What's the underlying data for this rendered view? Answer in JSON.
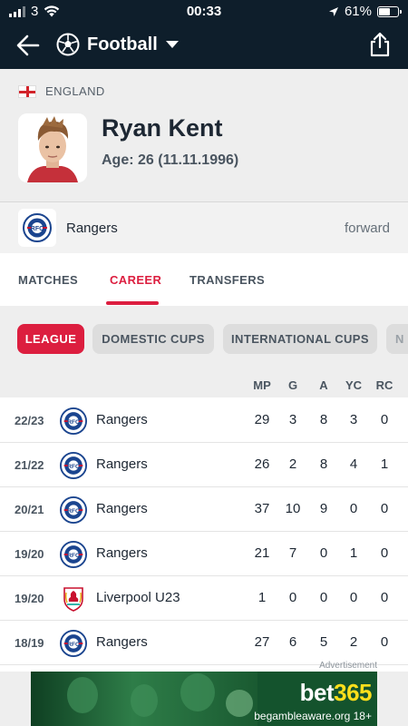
{
  "status_bar": {
    "carrier": "3",
    "time": "00:33",
    "battery": "61%",
    "battery_level": 0.61
  },
  "nav": {
    "sport": "Football",
    "icons": {
      "back": "back-arrow-icon",
      "sport": "football-icon",
      "dropdown": "chevron-down-icon",
      "share": "share-icon"
    }
  },
  "player": {
    "country": "ENGLAND",
    "name": "Ryan Kent",
    "age": "Age: 26 (11.11.1996)"
  },
  "team": {
    "name": "Rangers",
    "position": "forward"
  },
  "tabs": [
    {
      "label": "MATCHES",
      "active": false
    },
    {
      "label": "CAREER",
      "active": true
    },
    {
      "label": "TRANSFERS",
      "active": false
    }
  ],
  "filters": [
    {
      "label": "LEAGUE",
      "active": true
    },
    {
      "label": "DOMESTIC CUPS",
      "active": false
    },
    {
      "label": "INTERNATIONAL CUPS",
      "active": false
    },
    {
      "label": "N",
      "active": false
    }
  ],
  "career_table": {
    "columns": [
      "MP",
      "G",
      "A",
      "YC",
      "RC"
    ],
    "rows": [
      {
        "season": "22/23",
        "team": "Rangers",
        "crest": "rangers",
        "mp": "29",
        "g": "3",
        "a": "8",
        "yc": "3",
        "rc": "0"
      },
      {
        "season": "21/22",
        "team": "Rangers",
        "crest": "rangers",
        "mp": "26",
        "g": "2",
        "a": "8",
        "yc": "4",
        "rc": "1"
      },
      {
        "season": "20/21",
        "team": "Rangers",
        "crest": "rangers",
        "mp": "37",
        "g": "10",
        "a": "9",
        "yc": "0",
        "rc": "0"
      },
      {
        "season": "19/20",
        "team": "Rangers",
        "crest": "rangers",
        "mp": "21",
        "g": "7",
        "a": "0",
        "yc": "1",
        "rc": "0"
      },
      {
        "season": "19/20",
        "team": "Liverpool U23",
        "crest": "liverpool",
        "mp": "1",
        "g": "0",
        "a": "0",
        "yc": "0",
        "rc": "0"
      },
      {
        "season": "18/19",
        "team": "Rangers",
        "crest": "rangers",
        "mp": "27",
        "g": "6",
        "a": "5",
        "yc": "2",
        "rc": "0"
      }
    ]
  },
  "ad": {
    "label": "Advertisement",
    "brand_a": "bet",
    "brand_b": "365",
    "disclaimer": "begambleaware.org 18+"
  },
  "colors": {
    "nav_bg": "#0e1e2b",
    "accent": "#dc1e3f",
    "page_bg": "#eeeeee"
  }
}
